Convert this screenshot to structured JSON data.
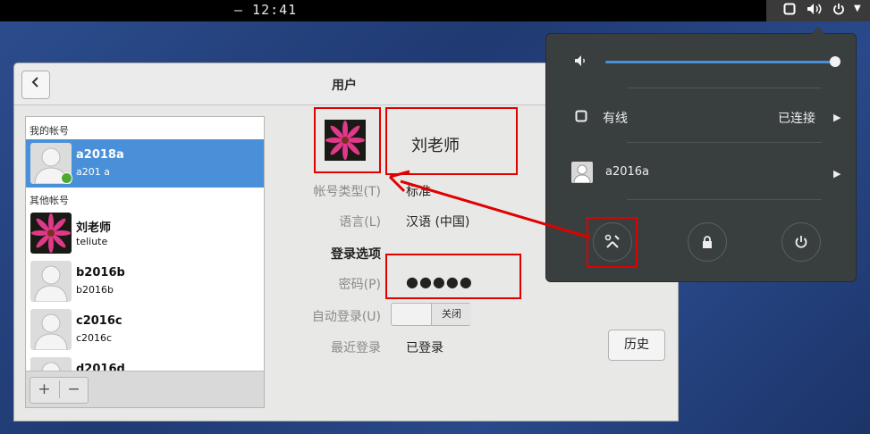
{
  "topbar": {
    "clock": "— 12:41"
  },
  "window": {
    "title": "用户",
    "back_icon": "chevron-left-icon",
    "sidebar": {
      "my_account_header": "我的帐号",
      "other_accounts_header": "其他帐号",
      "users": [
        {
          "name": "a2018a",
          "sub": "a201  a"
        },
        {
          "name": "刘老师",
          "sub": "teliute"
        },
        {
          "name": "b2016b",
          "sub": "b2016b"
        },
        {
          "name": "c2016c",
          "sub": "c2016c"
        },
        {
          "name": "d2016d",
          "sub": ""
        }
      ],
      "add_label": "+",
      "remove_label": "−"
    },
    "details": {
      "full_name": "刘老师",
      "account_type_label": "帐号类型(T)",
      "account_type_value": "标准",
      "language_label": "语言(L)",
      "language_value": "汉语 (中国)",
      "login_options_header": "登录选项",
      "password_label": "密码(P)",
      "password_value": "●●●●●",
      "autologin_label": "自动登录(U)",
      "autologin_state": "关闭",
      "last_login_label": "最近登录",
      "last_login_value": "已登录",
      "history_button": "历史"
    }
  },
  "system_menu": {
    "volume_fraction": 0.99,
    "wired_label": "有线",
    "wired_status": "已连接",
    "user_label": "a2016a",
    "colors": {
      "accent": "#4a90d9",
      "annotation": "#e00000"
    }
  }
}
